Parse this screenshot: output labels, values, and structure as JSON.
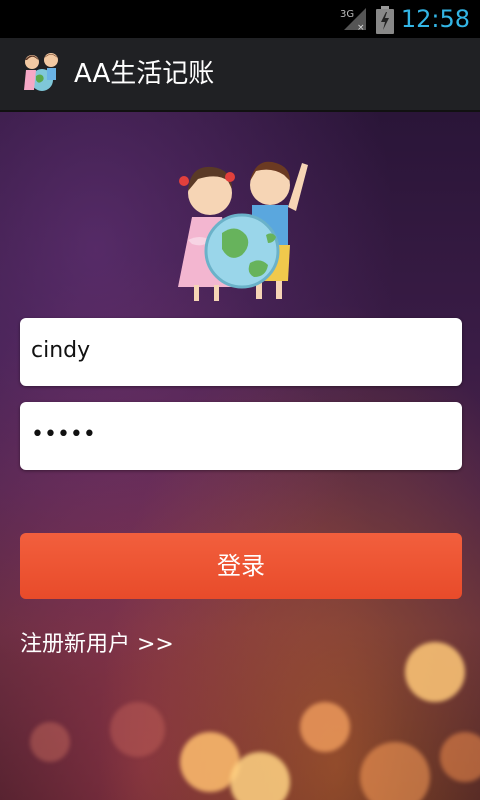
{
  "status_bar": {
    "network_label": "3G",
    "time": "12:58",
    "accent_color": "#33b5e5"
  },
  "action_bar": {
    "title": "AA生活记账",
    "icon": "kids-globe-icon"
  },
  "login_form": {
    "logo": "kids-globe-logo",
    "username_value": "cindy",
    "password_value": "•••••",
    "login_label": "登录",
    "register_link": "注册新用户 >>"
  },
  "colors": {
    "button": "#ea5330",
    "actionbar": "#202124"
  }
}
